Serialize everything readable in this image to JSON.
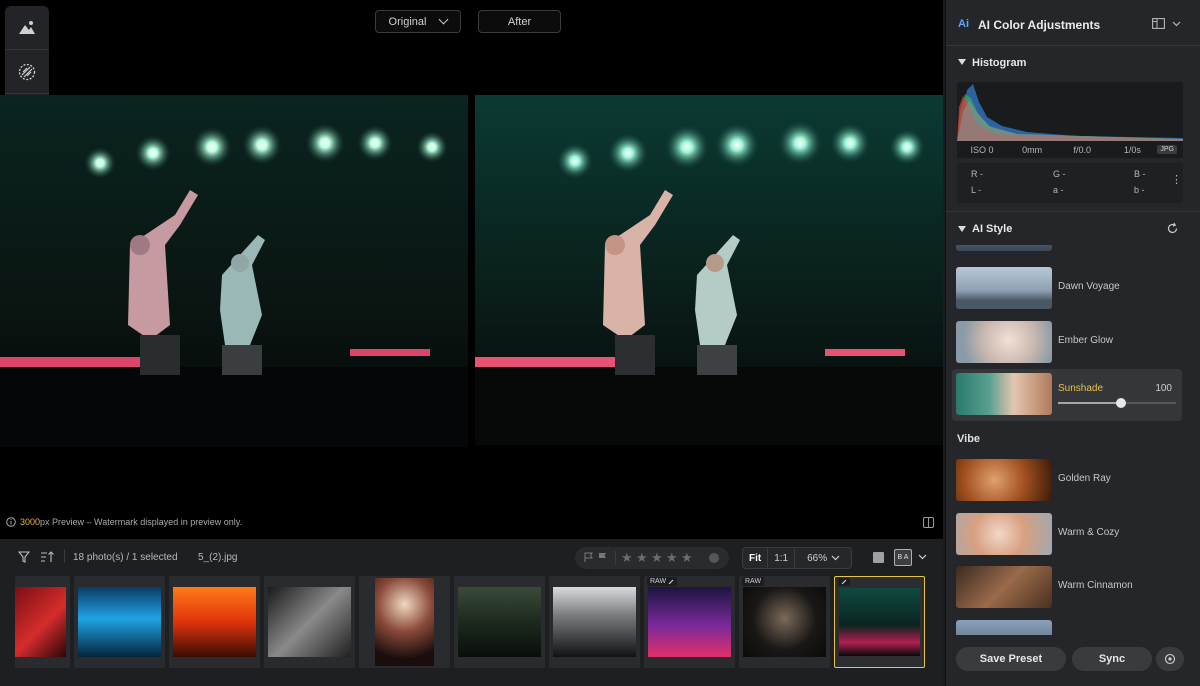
{
  "viewer": {
    "compare_left": "Original",
    "compare_right": "After",
    "preview_size": "3000",
    "preview_note": "px Preview – Watermark displayed in preview only."
  },
  "tools": [
    "portrait-ai-icon",
    "texture-icon",
    "history-icon"
  ],
  "filmstrip": {
    "count_text": "18 photo(s) / 1 selected",
    "filename": "5_(2).jpg",
    "zoom_fit": "Fit",
    "zoom_one": "1:1",
    "zoom_percent": "66%",
    "ba_label": "B A",
    "raw_label": "RAW",
    "stars": [
      "★",
      "★",
      "★",
      "★",
      "★"
    ]
  },
  "panel": {
    "ai_badge": "Ai",
    "title": "AI Color Adjustments",
    "histogram_title": "Histogram",
    "iso": "ISO 0",
    "focal": "0mm",
    "aperture": "f/0.0",
    "shutter": "1/0s",
    "format": "JPG",
    "r": "R -",
    "g": "G -",
    "b": "B -",
    "l": "L -",
    "a": "a -",
    "b2": "b -",
    "style_title": "AI Style",
    "styles": [
      {
        "label": "Dawn Voyage"
      },
      {
        "label": "Ember Glow"
      },
      {
        "label": "Sunshade",
        "value": "100"
      }
    ],
    "vibe_title": "Vibe",
    "vibe_styles": [
      {
        "label": "Golden Ray"
      },
      {
        "label": "Warm & Cozy"
      },
      {
        "label": "Warm Cinnamon"
      }
    ],
    "save_preset": "Save Preset",
    "sync": "Sync"
  }
}
